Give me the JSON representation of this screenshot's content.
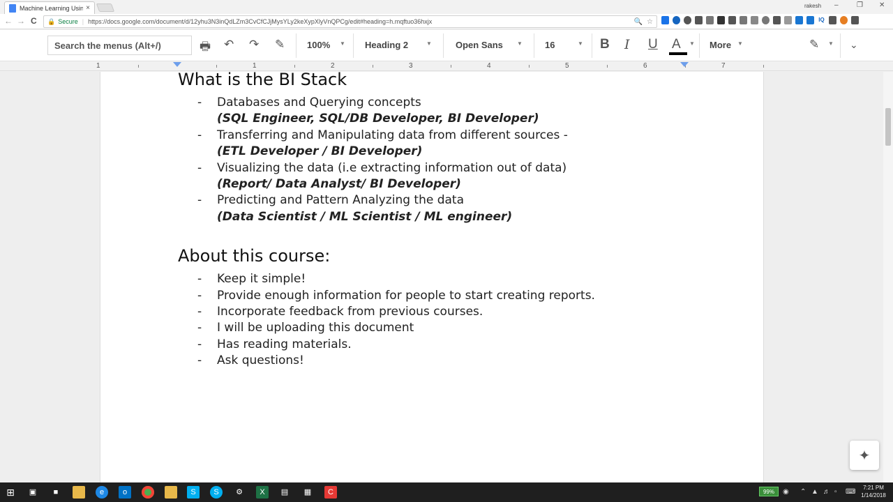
{
  "browser": {
    "tab_title": "Machine Learning Using",
    "tab_close": "×",
    "profile_name": "rakesh",
    "window_controls": [
      "–",
      "❐",
      "✕"
    ],
    "nav": [
      "←",
      "→",
      "C"
    ],
    "secure_label": "Secure",
    "url": "https://docs.google.com/document/d/12yhu3N3inQdLZm3CvCfCJjMysYLy2keXypXlyVnQPCg/edit#heading=h.mqftuo36hxjx",
    "omni_icons": [
      "zoom-icon",
      "star-icon"
    ],
    "extensions": [
      {
        "name": "ext-1-icon",
        "color": "#1a73e8"
      },
      {
        "name": "ext-2-icon",
        "color": "#1565c0"
      },
      {
        "name": "ext-3-icon",
        "color": "#555555"
      },
      {
        "name": "ext-4-icon",
        "color": "#555555"
      },
      {
        "name": "ext-5-icon",
        "color": "#777777"
      },
      {
        "name": "ext-6-icon",
        "color": "#333333"
      },
      {
        "name": "ext-7-icon",
        "color": "#555555"
      },
      {
        "name": "ext-8-icon",
        "color": "#777777"
      },
      {
        "name": "ext-9-icon",
        "color": "#888888"
      },
      {
        "name": "ext-10-icon",
        "color": "#777777"
      },
      {
        "name": "ext-11-icon",
        "color": "#555555"
      },
      {
        "name": "ext-12-icon",
        "color": "#999999"
      },
      {
        "name": "ext-13-icon",
        "color": "#1976d2"
      },
      {
        "name": "ext-14-icon",
        "color": "#1976d2"
      },
      {
        "name": "ext-15-icon",
        "color": "#1565c0"
      },
      {
        "name": "ext-16-icon",
        "color": "#555555"
      },
      {
        "name": "ext-17-icon",
        "color": "#e67e22"
      },
      {
        "name": "ext-18-icon",
        "color": "#555555"
      }
    ],
    "ext_16_label": "IQ"
  },
  "toolbar": {
    "search_menus": "Search the menus (Alt+/)",
    "zoom": "100%",
    "style": "Heading 2",
    "font": "Open Sans",
    "size": "16",
    "more": "More",
    "bold": "B",
    "italic": "I",
    "underline": "U",
    "text_color": "A",
    "text_color_swatch": "#000000"
  },
  "ruler": {
    "numbers": [
      "1",
      "1",
      "2",
      "3",
      "4",
      "5",
      "6",
      "7"
    ],
    "marker_color": "#6d9eeb"
  },
  "document": {
    "heading1": "What is the BI Stack",
    "bi_items": [
      {
        "text": "Databases and Querying concepts",
        "role": "(SQL Engineer, SQL/DB Developer, BI Developer)"
      },
      {
        "text": "Transferring and Manipulating data from different sources  -",
        "role": "(ETL Developer / BI Developer)"
      },
      {
        "text": "Visualizing the data (i.e extracting information out of data)",
        "role": "(Report/ Data Analyst/ BI Developer)"
      },
      {
        "text": "Predicting and Pattern Analyzing the data",
        "role": "(Data Scientist / ML Scientist / ML engineer)"
      }
    ],
    "heading2": "About this course:",
    "course_items": [
      "Keep it simple!",
      "Provide enough information for people to start creating reports.",
      "Incorporate feedback from previous courses.",
      "I will be uploading this document",
      "Has reading materials.",
      "Ask questions!"
    ],
    "dash": "-"
  },
  "taskbar": {
    "apps": [
      {
        "name": "windows-start-icon",
        "color": "#1f1f1f"
      },
      {
        "name": "task-view-icon",
        "color": "#1f1f1f"
      },
      {
        "name": "store-icon",
        "color": "#1f1f1f"
      },
      {
        "name": "file-explorer-icon",
        "color": "#e8b84a"
      },
      {
        "name": "edge-icon",
        "color": "#1e88e5"
      },
      {
        "name": "outlook-icon",
        "color": "#0072c6"
      },
      {
        "name": "chrome-icon",
        "color": "#4caf50"
      },
      {
        "name": "folder-icon",
        "color": "#e8b84a"
      },
      {
        "name": "skype-for-business-icon",
        "color": "#00aff0"
      },
      {
        "name": "skype-icon",
        "color": "#00aff0"
      },
      {
        "name": "app-icon",
        "color": "#1f1f1f"
      },
      {
        "name": "excel-icon",
        "color": "#1e7145"
      },
      {
        "name": "window-app-icon",
        "color": "#1f1f1f"
      },
      {
        "name": "calculator-icon",
        "color": "#1f1f1f"
      },
      {
        "name": "camtasia-icon",
        "color": "#e53935"
      }
    ],
    "battery": "99%",
    "time": "7:21 PM",
    "date": "1/14/2018"
  }
}
